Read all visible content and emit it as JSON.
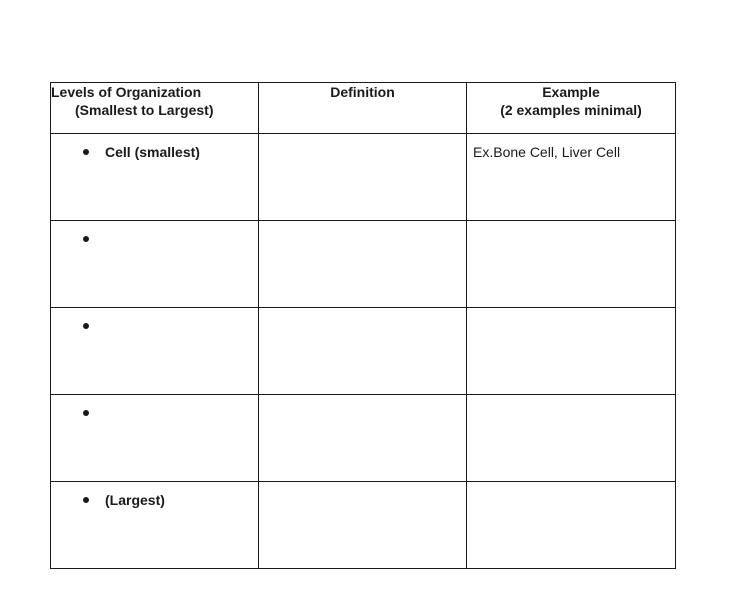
{
  "table": {
    "headers": {
      "levels": {
        "line1": "Levels of Organization",
        "line2": "(Smallest to Largest)"
      },
      "definition": "Definition",
      "example": {
        "line1": "Example",
        "line2": "(2 examples minimal)"
      }
    },
    "rows": [
      {
        "level": "Cell (smallest)",
        "level_line2": "",
        "definition": "",
        "example": "Ex.Bone Cell, Liver Cell"
      },
      {
        "level": "",
        "level_line2": "",
        "definition": "",
        "example": ""
      },
      {
        "level": "",
        "level_line2": "",
        "definition": "",
        "example": ""
      },
      {
        "level": "",
        "level_line2": "",
        "definition": "",
        "example": ""
      },
      {
        "level": "",
        "level_line2": "(Largest)",
        "definition": "",
        "example": ""
      }
    ]
  }
}
